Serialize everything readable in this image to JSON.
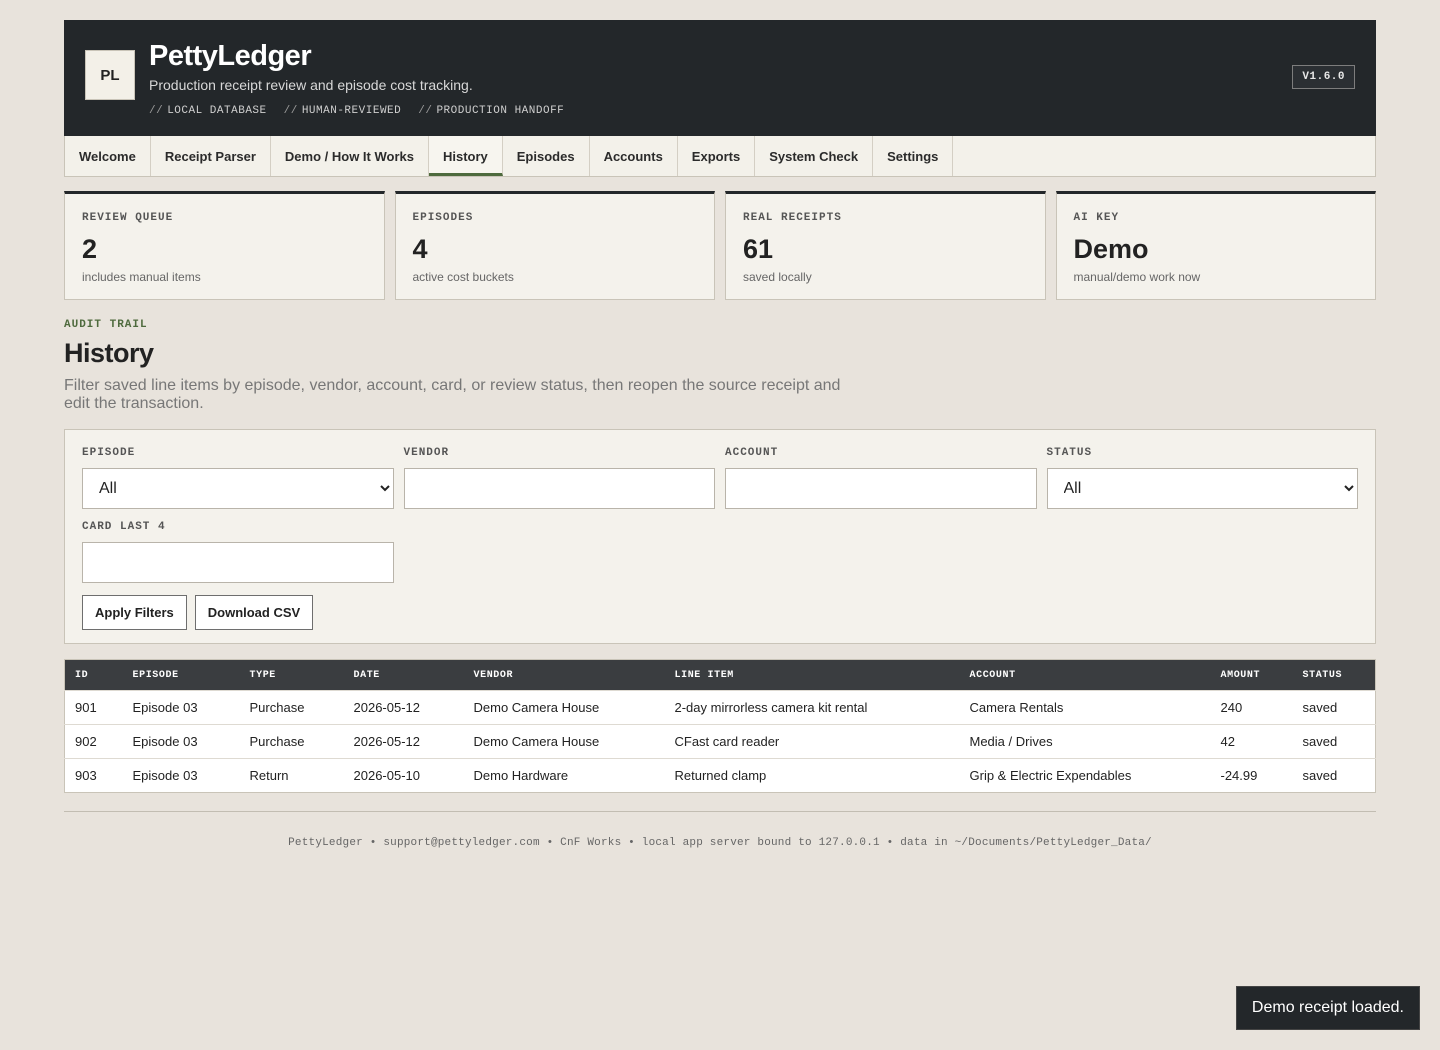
{
  "header": {
    "logo": "PL",
    "title": "PettyLedger",
    "subtitle": "Production receipt review and episode cost tracking.",
    "tags": [
      "LOCAL DATABASE",
      "HUMAN-REVIEWED",
      "PRODUCTION HANDOFF"
    ],
    "tag_prefix": "//",
    "version": "V1.6.0"
  },
  "nav": {
    "items": [
      "Welcome",
      "Receipt Parser",
      "Demo / How It Works",
      "History",
      "Episodes",
      "Accounts",
      "Exports",
      "System Check",
      "Settings"
    ],
    "active": "History"
  },
  "stats": [
    {
      "label": "REVIEW QUEUE",
      "value": "2",
      "note": "includes manual items"
    },
    {
      "label": "EPISODES",
      "value": "4",
      "note": "active cost buckets"
    },
    {
      "label": "REAL RECEIPTS",
      "value": "61",
      "note": "saved locally"
    },
    {
      "label": "AI KEY",
      "value": "Demo",
      "note": "manual/demo work now"
    }
  ],
  "section": {
    "eyebrow": "AUDIT TRAIL",
    "title": "History",
    "description": "Filter saved line items by episode, vendor, account, card, or review status, then reopen the source receipt and edit the transaction."
  },
  "filters": {
    "episode": {
      "label": "EPISODE",
      "value": "All"
    },
    "vendor": {
      "label": "VENDOR",
      "value": ""
    },
    "account": {
      "label": "ACCOUNT",
      "value": ""
    },
    "status": {
      "label": "STATUS",
      "value": "All"
    },
    "card": {
      "label": "CARD LAST 4",
      "value": ""
    },
    "apply_label": "Apply Filters",
    "download_label": "Download CSV"
  },
  "table": {
    "headers": [
      "ID",
      "EPISODE",
      "TYPE",
      "DATE",
      "VENDOR",
      "LINE ITEM",
      "ACCOUNT",
      "AMOUNT",
      "STATUS"
    ],
    "rows": [
      [
        "901",
        "Episode 03",
        "Purchase",
        "2026-05-12",
        "Demo Camera House",
        "2-day mirrorless camera kit rental",
        "Camera Rentals",
        "240",
        "saved"
      ],
      [
        "902",
        "Episode 03",
        "Purchase",
        "2026-05-12",
        "Demo Camera House",
        "CFast card reader",
        "Media / Drives",
        "42",
        "saved"
      ],
      [
        "903",
        "Episode 03",
        "Return",
        "2026-05-10",
        "Demo Hardware",
        "Returned clamp",
        "Grip & Electric Expendables",
        "-24.99",
        "saved"
      ]
    ]
  },
  "footer": "PettyLedger • support@pettyledger.com • CnF Works • local app server bound to 127.0.0.1 • data in ~/Documents/PettyLedger_Data/",
  "toast": "Demo receipt loaded.",
  "colors": {
    "header_bg": "#23272a",
    "accent": "#4e6a3d",
    "page_bg": "#e8e3dc"
  }
}
